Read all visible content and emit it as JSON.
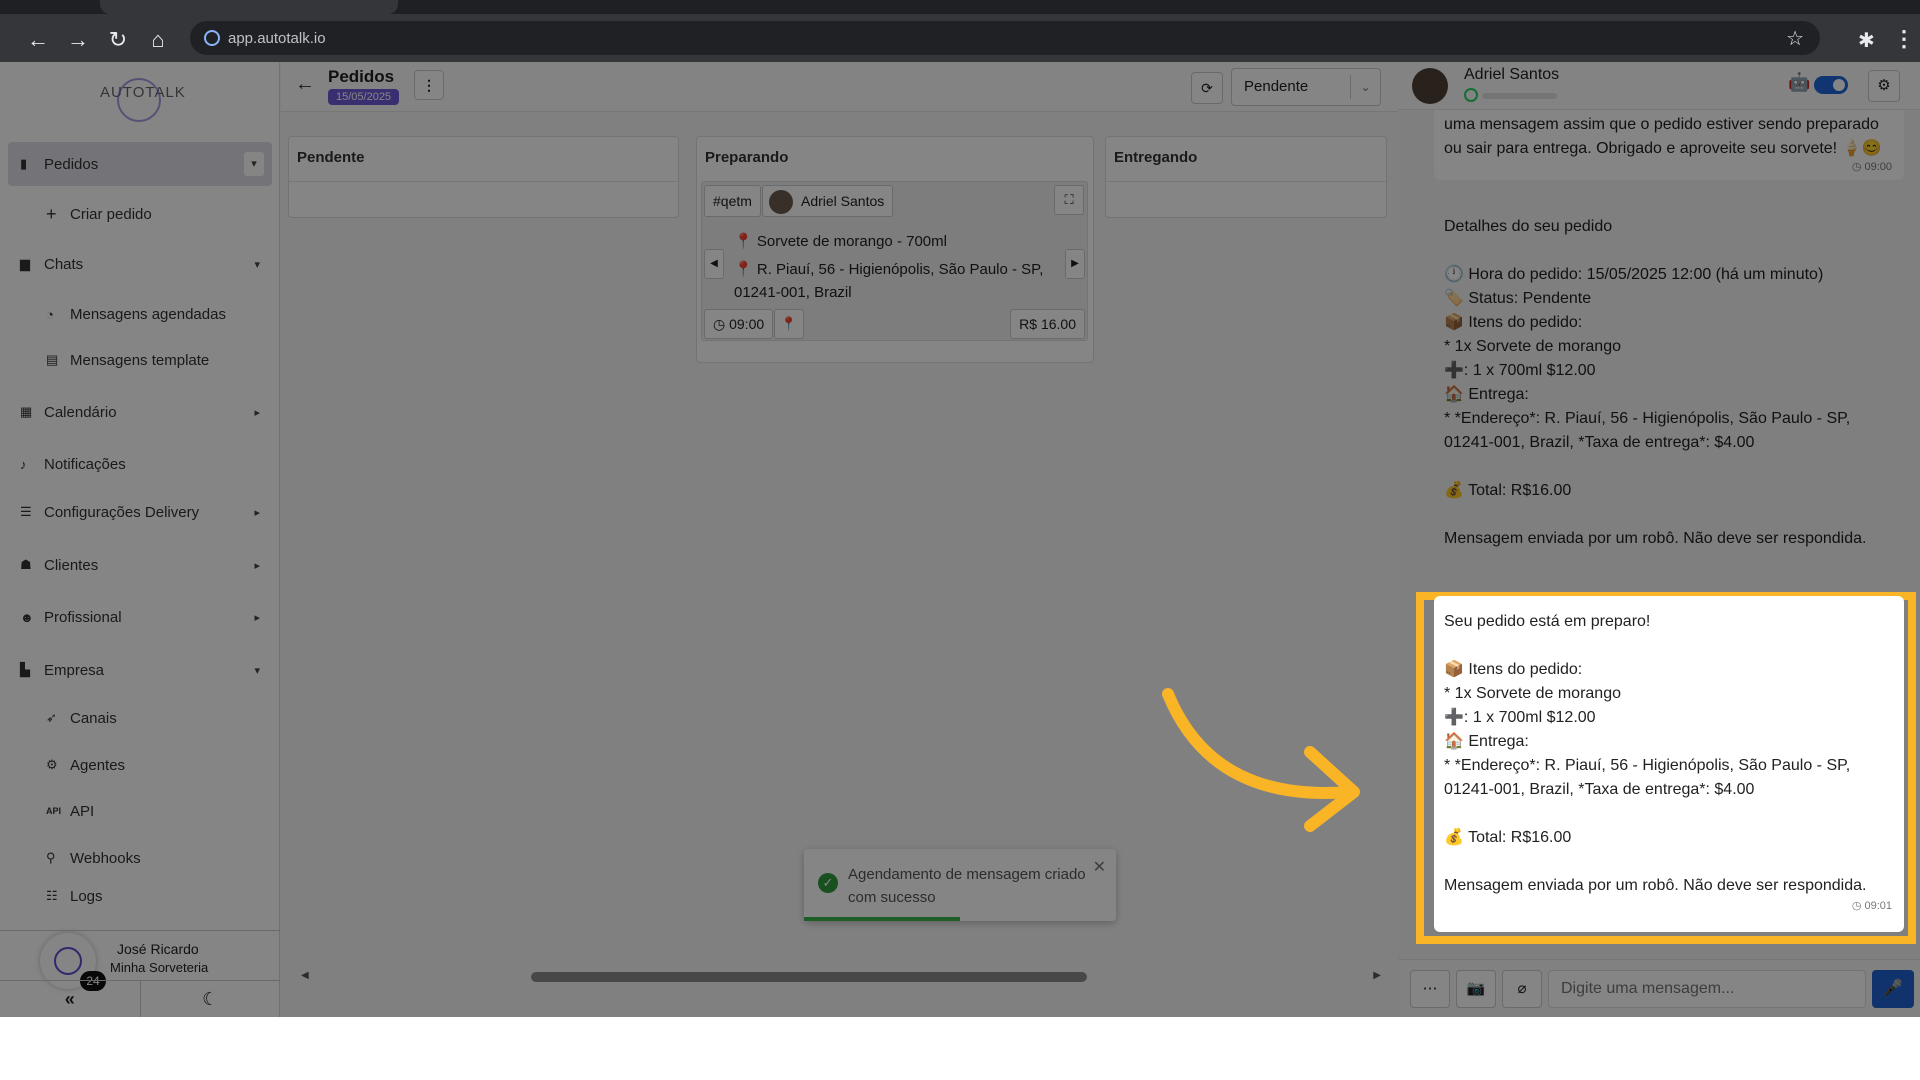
{
  "browser": {
    "url": "app.autotalk.io"
  },
  "sidebar": {
    "logo": "AUTOTALK",
    "items": [
      {
        "label": "Pedidos",
        "icon": "clipboard-icon"
      },
      {
        "label": "Criar pedido",
        "icon": "plus-icon"
      },
      {
        "label": "Chats",
        "icon": "chat-icon"
      },
      {
        "label": "Mensagens agendadas",
        "icon": "clock-icon"
      },
      {
        "label": "Mensagens template",
        "icon": "template-icon"
      },
      {
        "label": "Calendário",
        "icon": "calendar-icon"
      },
      {
        "label": "Notificações",
        "icon": "bell-icon"
      },
      {
        "label": "Configurações Delivery",
        "icon": "sliders-icon"
      },
      {
        "label": "Clientes",
        "icon": "users-icon"
      },
      {
        "label": "Profissional",
        "icon": "user-gear-icon"
      },
      {
        "label": "Empresa",
        "icon": "building-icon"
      },
      {
        "label": "Canais",
        "icon": "rocket-icon"
      },
      {
        "label": "Agentes",
        "icon": "robot-icon"
      },
      {
        "label": "API",
        "icon": "api-icon"
      },
      {
        "label": "Webhooks",
        "icon": "webhook-icon"
      },
      {
        "label": "Logs",
        "icon": "list-icon"
      }
    ],
    "user": {
      "name": "José Ricardo",
      "company": "Minha Sorveteria",
      "badge": "24"
    }
  },
  "orders": {
    "title": "Pedidos",
    "date": "15/05/2025",
    "status_filter": "Pendente",
    "columns": [
      "Pendente",
      "Preparando",
      "Entregando"
    ],
    "card": {
      "code": "#qetm",
      "customer": "Adriel Santos",
      "item": "Sorvete de morango - 700ml",
      "address": "R. Piauí, 56 - Higienópolis, São Paulo - SP, 01241-001, Brazil",
      "time": "09:00",
      "price": "R$ 16.00"
    },
    "toast": "Agendamento de mensagem criado com sucesso"
  },
  "chat": {
    "contact": "Adriel Santos",
    "messages": [
      {
        "text": "aguardar a confirmação do estabelecimento. Você receberá uma mensagem assim que o pedido estiver sendo preparado ou sair para entrega. Obrigado e aproveite seu sorvete! 🍦😊",
        "time": "09:00"
      },
      {
        "text": "Detalhes do seu pedido\n\n🕛 Hora do pedido: 15/05/2025 12:00 (há um minuto)\n🏷️ Status: Pendente\n📦 Itens do pedido:\n* 1x Sorvete de morango\n➕: 1 x 700ml $12.00\n🏠 Entrega:\n* *Endereço*: R. Piauí, 56 - Higienópolis, São Paulo - SP, 01241-001, Brazil, *Taxa de entrega*: $4.00\n\n💰 Total: R$16.00\n\nMensagem enviada por um robô. Não deve ser respondida."
      },
      {
        "text": "Seu pedido está em preparo!\n\n📦 Itens do pedido:\n* 1x Sorvete de morango\n➕: 1 x 700ml $12.00\n🏠 Entrega:\n* *Endereço*: R. Piauí, 56 - Higienópolis, São Paulo - SP, 01241-001, Brazil, *Taxa de entrega*: $4.00\n\n💰 Total: R$16.00\n\nMensagem enviada por um robô. Não deve ser respondida.",
        "time": "09:01"
      }
    ],
    "input_placeholder": "Digite uma mensagem..."
  },
  "colors": {
    "highlight": "#f9b526",
    "accent": "#6e5bd6",
    "primary_blue": "#1f63d4",
    "success": "#2e9b3c"
  }
}
